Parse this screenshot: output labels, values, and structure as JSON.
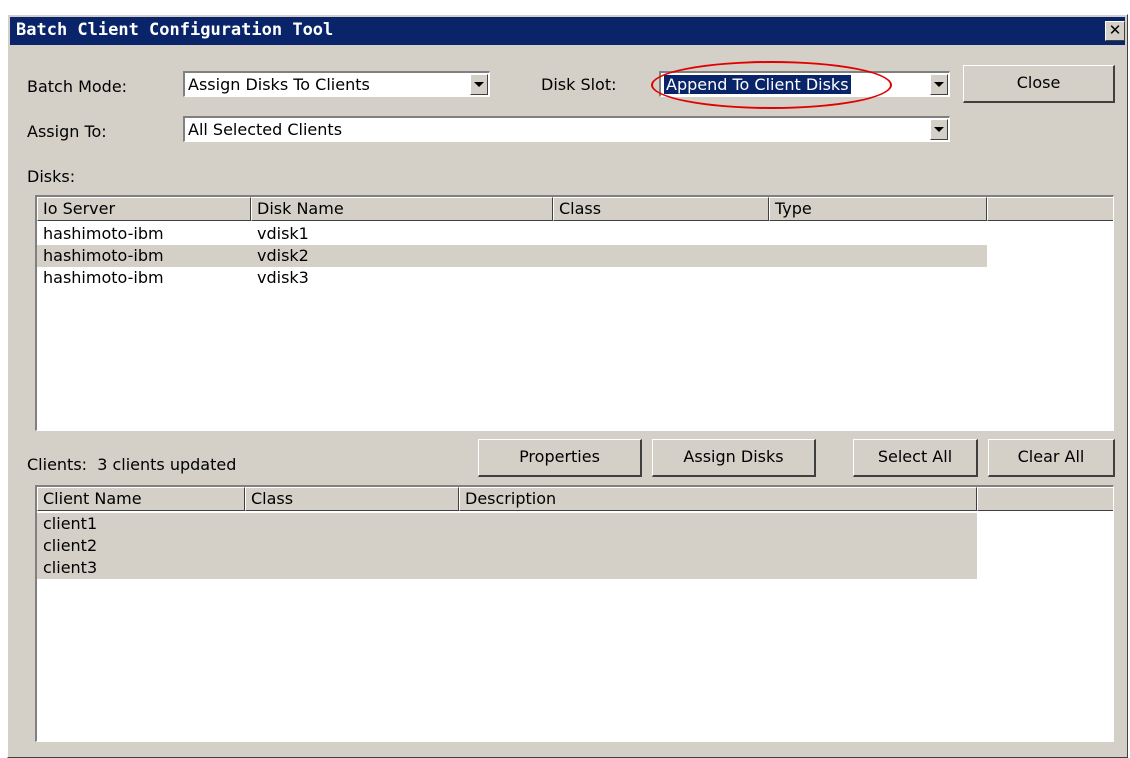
{
  "window": {
    "title": "Batch Client Configuration Tool",
    "close_glyph": "✕"
  },
  "batch_mode": {
    "label": "Batch Mode:",
    "value": "Assign Disks To Clients"
  },
  "disk_slot": {
    "label": "Disk Slot:",
    "value": "Append To Client Disks"
  },
  "assign_to": {
    "label": "Assign To:",
    "value": "All Selected Clients"
  },
  "buttons": {
    "close": "Close",
    "properties": "Properties",
    "assign_disks": "Assign Disks",
    "select_all": "Select All",
    "clear_all": "Clear All"
  },
  "disks": {
    "label": "Disks:",
    "columns": [
      "Io Server",
      "Disk Name",
      "Class",
      "Type",
      ""
    ],
    "rows": [
      {
        "server": "hashimoto-ibm",
        "disk": "vdisk1",
        "class": "",
        "type": "",
        "selected": false
      },
      {
        "server": "hashimoto-ibm",
        "disk": "vdisk2",
        "class": "",
        "type": "",
        "selected": true
      },
      {
        "server": "hashimoto-ibm",
        "disk": "vdisk3",
        "class": "",
        "type": "",
        "selected": false
      }
    ]
  },
  "clients": {
    "label": "Clients:",
    "status": "3 clients updated",
    "columns": [
      "Client Name",
      "Class",
      "Description",
      ""
    ],
    "rows": [
      {
        "name": "client1",
        "class": "",
        "description": "",
        "selected": true
      },
      {
        "name": "client2",
        "class": "",
        "description": "",
        "selected": true
      },
      {
        "name": "client3",
        "class": "",
        "description": "",
        "selected": true
      }
    ]
  },
  "colors": {
    "titlebar": "#0a246a",
    "face": "#d4d0c8",
    "highlight_oval": "#e00000"
  }
}
